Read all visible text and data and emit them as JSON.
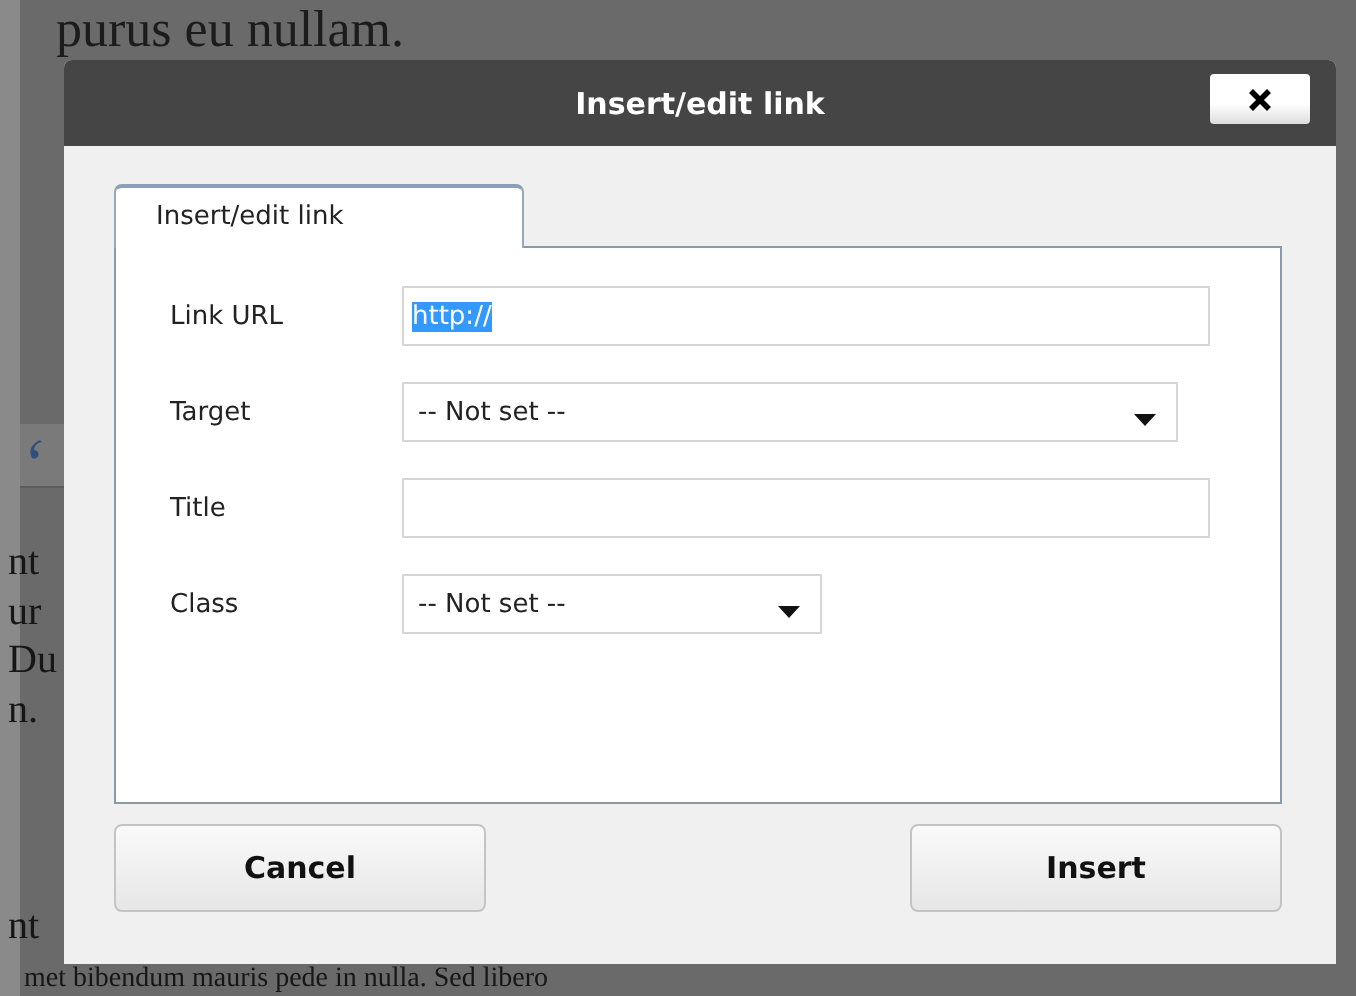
{
  "background_page": {
    "heading_fragment": "purus eu nullam.",
    "line_fragments": [
      "nt",
      "ur",
      "Du",
      "n.",
      "nt"
    ],
    "bottom_line": "met bibendum mauris pede in nulla. Sed libero"
  },
  "dialog": {
    "title": "Insert/edit link",
    "tabs": [
      {
        "label": "Insert/edit link",
        "selected": true
      }
    ],
    "fields": [
      {
        "label": "Link URL",
        "kind": "text",
        "value": "http://",
        "value_selected": true
      },
      {
        "label": "Target",
        "kind": "select",
        "value": "-- Not set --"
      },
      {
        "label": "Title",
        "kind": "text"
      },
      {
        "label": "Class",
        "kind": "select",
        "value": "-- Not set --"
      }
    ],
    "buttons": [
      "Cancel",
      "Insert"
    ]
  }
}
